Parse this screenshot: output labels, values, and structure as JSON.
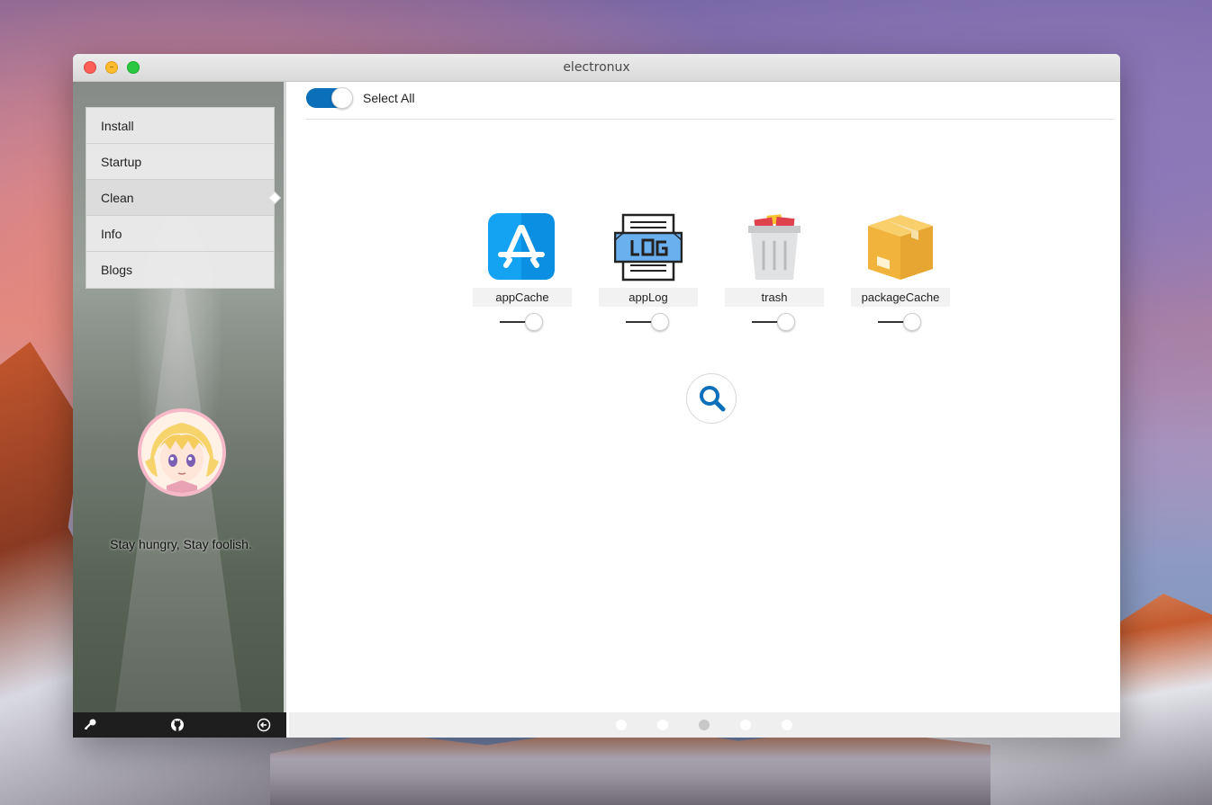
{
  "window": {
    "title": "electronux"
  },
  "sidebar": {
    "menu": [
      {
        "label": "Install",
        "active": false
      },
      {
        "label": "Startup",
        "active": false
      },
      {
        "label": "Clean",
        "active": true
      },
      {
        "label": "Info",
        "active": false
      },
      {
        "label": "Blogs",
        "active": false
      }
    ],
    "motto": "Stay hungry, Stay foolish.",
    "footer_icons": [
      "key-icon",
      "github-icon",
      "logout-icon"
    ]
  },
  "main": {
    "select_all": {
      "label": "Select All",
      "checked": true
    },
    "items": [
      {
        "label": "appCache",
        "icon": "app-store-icon",
        "enabled": false
      },
      {
        "label": "appLog",
        "icon": "log-icon",
        "enabled": false
      },
      {
        "label": "trash",
        "icon": "trash-icon",
        "enabled": false
      },
      {
        "label": "packageCache",
        "icon": "package-icon",
        "enabled": false
      }
    ],
    "search_icon": "search-icon"
  },
  "pager": {
    "count": 5,
    "active_index": 2
  },
  "colors": {
    "accent": "#0b6fb9",
    "sidebar_footer": "#1e1e1e",
    "avatar_border": "#f6b9c7"
  }
}
